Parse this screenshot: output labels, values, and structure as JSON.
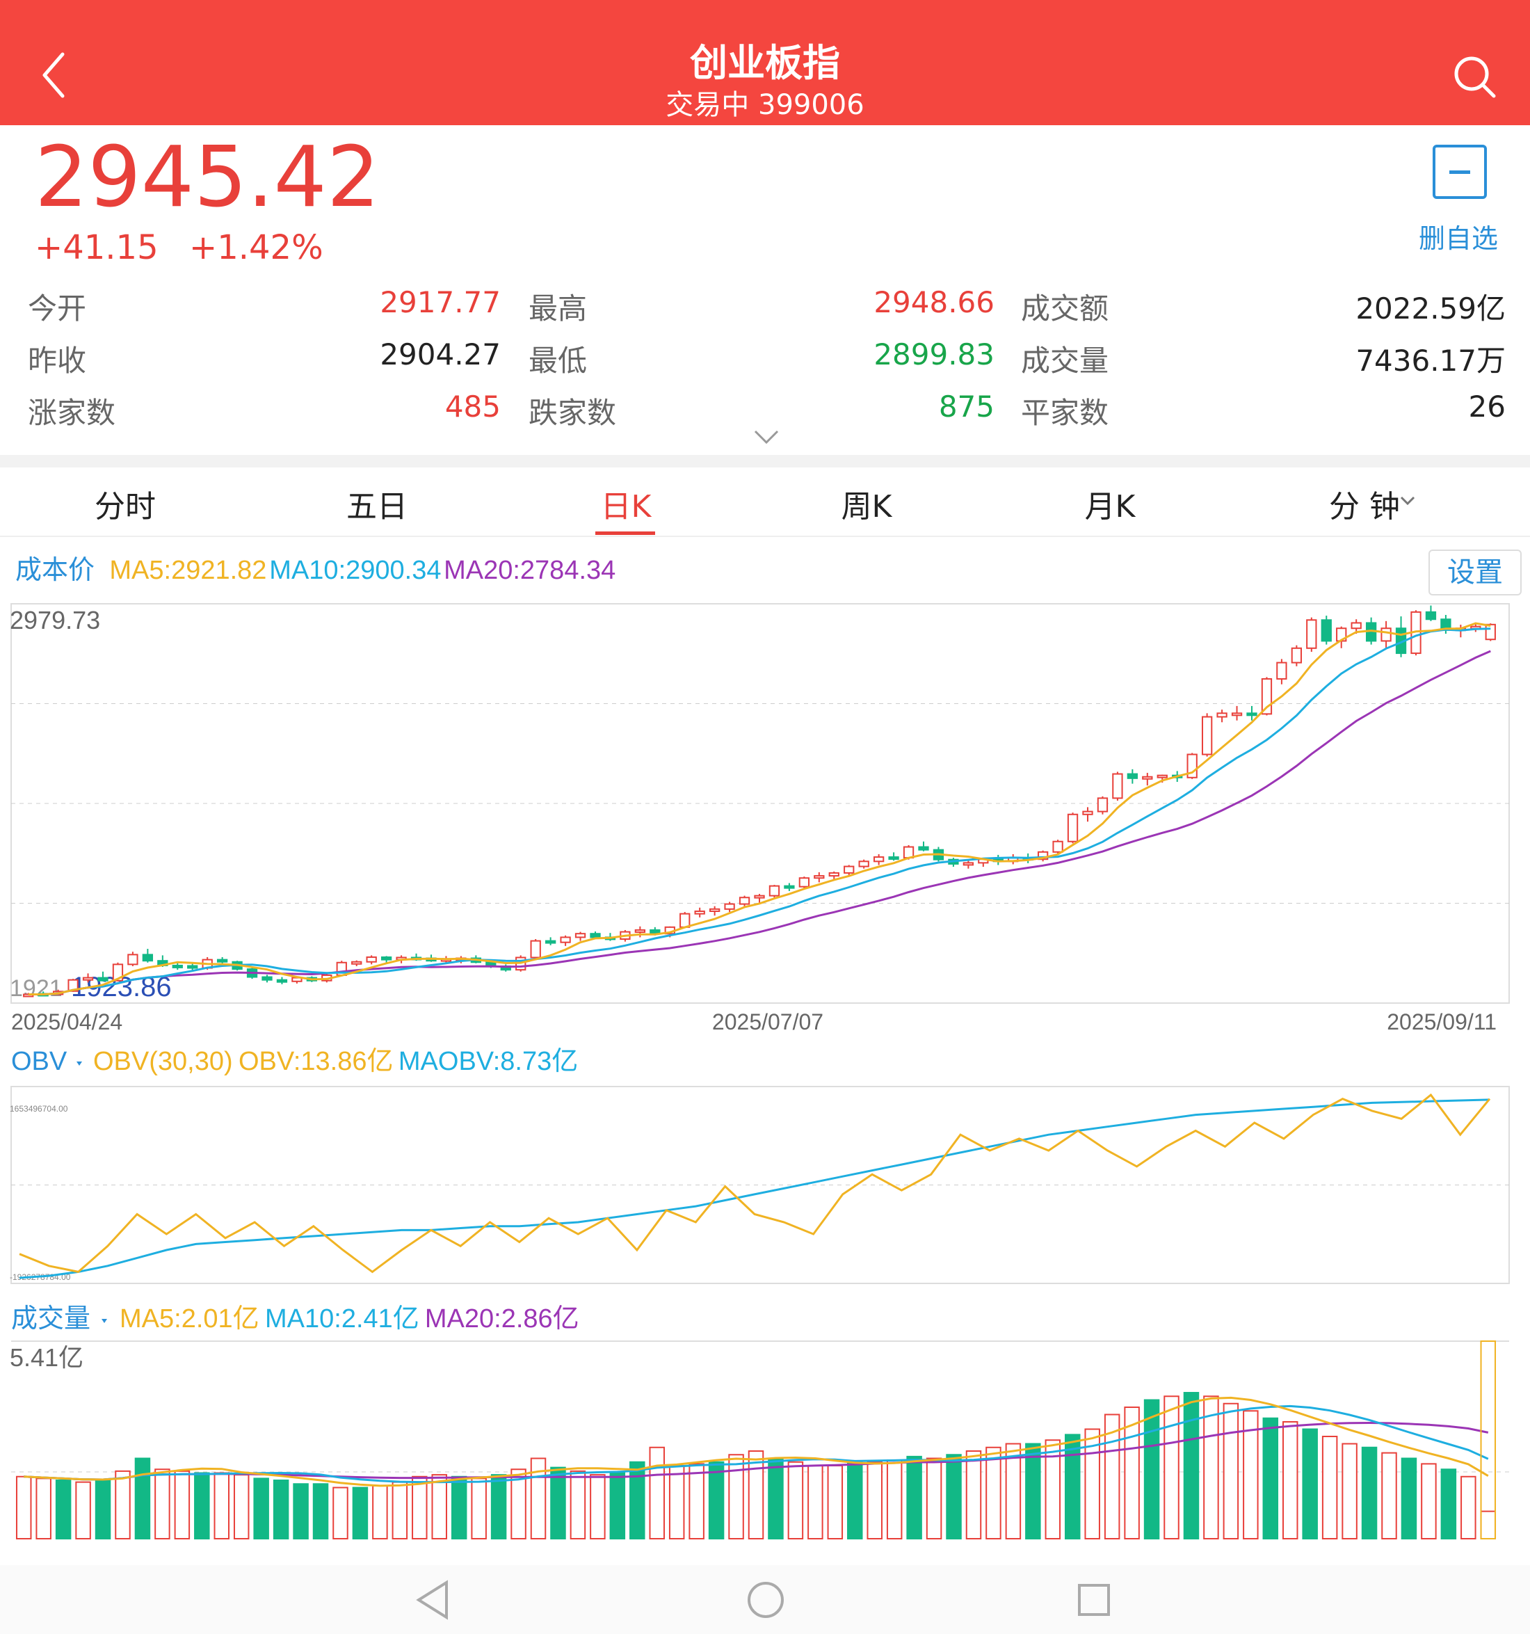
{
  "header": {
    "title": "创业板指",
    "subtitle": "交易中 399006"
  },
  "quote": {
    "price": "2945.42",
    "change": "+41.15",
    "change_pct": "+1.42%",
    "watch_label": "删自选",
    "stats": [
      [
        {
          "label": "今开",
          "value": "2917.77",
          "color": "red"
        },
        {
          "label": "最高",
          "value": "2948.66",
          "color": "red"
        },
        {
          "label": "成交额",
          "value": "2022.59亿",
          "color": "dark"
        }
      ],
      [
        {
          "label": "昨收",
          "value": "2904.27",
          "color": "dark"
        },
        {
          "label": "最低",
          "value": "2899.83",
          "color": "green"
        },
        {
          "label": "成交量",
          "value": "7436.17万",
          "color": "dark"
        }
      ],
      [
        {
          "label": "涨家数",
          "value": "485",
          "color": "red"
        },
        {
          "label": "跌家数",
          "value": "875",
          "color": "green"
        },
        {
          "label": "平家数",
          "value": "26",
          "color": "dark"
        }
      ]
    ]
  },
  "tabs": {
    "items": [
      "分时",
      "五日",
      "日K",
      "周K",
      "月K",
      "分 钟"
    ],
    "active": "日K"
  },
  "kline": {
    "cost_label": "成本价",
    "ma5": "MA5:2921.82",
    "ma10": "MA10:2900.34",
    "ma20": "MA20:2784.34",
    "settings": "设置",
    "y_max": "2979.73",
    "y_min_a": "1921",
    "y_min_b": "1923.86",
    "dates": [
      "2025/04/24",
      "2025/07/07",
      "2025/09/11"
    ]
  },
  "obv": {
    "label": "OBV",
    "params": "OBV(30,30)",
    "obv": "OBV:13.86亿",
    "maobv": "MAOBV:8.73亿",
    "y_max": "1653496704.00",
    "y_min": "-1926278784.00"
  },
  "volume": {
    "label": "成交量",
    "ma5": "MA5:2.01亿",
    "ma10": "MA10:2.41亿",
    "ma20": "MA20:2.86亿",
    "y_max": "5.41亿"
  },
  "colors": {
    "header": "#f4463f",
    "up": "#e8403a",
    "down": "#12b886",
    "ma5": "#f0b323",
    "ma10": "#1eaee0",
    "ma20": "#9b35b5",
    "link": "#2a8fd8"
  },
  "chart_data": [
    {
      "type": "candlestick",
      "title": "日K",
      "x_start": "2025/04/24",
      "x_end": "2025/09/11",
      "ylim": [
        1921,
        2979.73
      ],
      "ohlc": [
        [
          1921,
          1926,
          1918,
          1922
        ],
        [
          1924,
          1930,
          1919,
          1922
        ],
        [
          1922,
          1935,
          1920,
          1930
        ],
        [
          1931,
          1965,
          1929,
          1962
        ],
        [
          1962,
          1980,
          1955,
          1968
        ],
        [
          1968,
          1985,
          1958,
          1960
        ],
        [
          1960,
          2010,
          1958,
          2005
        ],
        [
          2005,
          2040,
          2000,
          2032
        ],
        [
          2032,
          2048,
          2010,
          2015
        ],
        [
          2015,
          2030,
          1998,
          2002
        ],
        [
          2002,
          2010,
          1990,
          2001
        ],
        [
          2001,
          2010,
          1985,
          1995
        ],
        [
          1995,
          2025,
          1990,
          2018
        ],
        [
          2018,
          2025,
          2006,
          2012
        ],
        [
          2012,
          2015,
          1988,
          1992
        ],
        [
          1992,
          1998,
          1965,
          1970
        ],
        [
          1970,
          1976,
          1955,
          1962
        ],
        [
          1962,
          1970,
          1950,
          1958
        ],
        [
          1958,
          1972,
          1952,
          1968
        ],
        [
          1968,
          1972,
          1956,
          1960
        ],
        [
          1960,
          1978,
          1955,
          1975
        ],
        [
          1975,
          2015,
          1972,
          2010
        ],
        [
          2010,
          2016,
          2000,
          2012
        ],
        [
          2012,
          2030,
          2005,
          2025
        ],
        [
          2025,
          2028,
          2010,
          2018
        ],
        [
          2018,
          2030,
          2008,
          2024
        ],
        [
          2024,
          2035,
          2015,
          2022
        ],
        [
          2022,
          2032,
          2012,
          2015
        ],
        [
          2015,
          2028,
          2010,
          2020
        ],
        [
          2020,
          2028,
          2008,
          2022
        ],
        [
          2022,
          2030,
          2008,
          2011
        ],
        [
          2011,
          2015,
          1995,
          2000
        ],
        [
          2000,
          2005,
          1985,
          1990
        ],
        [
          1990,
          2030,
          1985,
          2024
        ],
        [
          2024,
          2075,
          2020,
          2070
        ],
        [
          2070,
          2080,
          2058,
          2066
        ],
        [
          2066,
          2085,
          2056,
          2080
        ],
        [
          2080,
          2095,
          2070,
          2090
        ],
        [
          2090,
          2096,
          2075,
          2080
        ],
        [
          2080,
          2092,
          2070,
          2075
        ],
        [
          2075,
          2100,
          2068,
          2095
        ],
        [
          2095,
          2110,
          2080,
          2100
        ],
        [
          2100,
          2108,
          2085,
          2090
        ],
        [
          2090,
          2110,
          2080,
          2108
        ],
        [
          2108,
          2150,
          2105,
          2145
        ],
        [
          2145,
          2162,
          2135,
          2152
        ],
        [
          2152,
          2166,
          2140,
          2158
        ],
        [
          2158,
          2178,
          2150,
          2172
        ],
        [
          2172,
          2195,
          2165,
          2190
        ],
        [
          2190,
          2200,
          2175,
          2195
        ],
        [
          2195,
          2225,
          2190,
          2222
        ],
        [
          2222,
          2230,
          2208,
          2220
        ],
        [
          2220,
          2248,
          2215,
          2244
        ],
        [
          2244,
          2260,
          2232,
          2250
        ],
        [
          2250,
          2262,
          2240,
          2258
        ],
        [
          2258,
          2280,
          2250,
          2276
        ],
        [
          2276,
          2295,
          2270,
          2290
        ],
        [
          2290,
          2310,
          2280,
          2302
        ],
        [
          2302,
          2315,
          2292,
          2300
        ],
        [
          2300,
          2335,
          2295,
          2330
        ],
        [
          2330,
          2345,
          2318,
          2322
        ],
        [
          2322,
          2330,
          2290,
          2295
        ],
        [
          2295,
          2300,
          2275,
          2283
        ],
        [
          2283,
          2292,
          2270,
          2286
        ],
        [
          2286,
          2298,
          2275,
          2296
        ],
        [
          2296,
          2308,
          2280,
          2290
        ],
        [
          2290,
          2310,
          2282,
          2300
        ],
        [
          2300,
          2312,
          2285,
          2296
        ],
        [
          2296,
          2320,
          2290,
          2316
        ],
        [
          2316,
          2350,
          2310,
          2345
        ],
        [
          2345,
          2425,
          2340,
          2420
        ],
        [
          2420,
          2440,
          2400,
          2428
        ],
        [
          2428,
          2470,
          2420,
          2465
        ],
        [
          2465,
          2538,
          2458,
          2532
        ],
        [
          2532,
          2545,
          2505,
          2520
        ],
        [
          2520,
          2535,
          2500,
          2524
        ],
        [
          2524,
          2530,
          2508,
          2528
        ],
        [
          2528,
          2540,
          2510,
          2522
        ],
        [
          2522,
          2590,
          2518,
          2586
        ],
        [
          2586,
          2700,
          2580,
          2690
        ],
        [
          2690,
          2710,
          2675,
          2700
        ],
        [
          2700,
          2720,
          2680,
          2700
        ],
        [
          2700,
          2720,
          2680,
          2698
        ],
        [
          2698,
          2800,
          2694,
          2795
        ],
        [
          2795,
          2850,
          2780,
          2840
        ],
        [
          2840,
          2888,
          2830,
          2880
        ],
        [
          2880,
          2965,
          2870,
          2958
        ],
        [
          2958,
          2970,
          2890,
          2900
        ],
        [
          2900,
          2940,
          2880,
          2935
        ],
        [
          2935,
          2960,
          2920,
          2950
        ],
        [
          2950,
          2965,
          2890,
          2900
        ],
        [
          2900,
          2955,
          2880,
          2935
        ],
        [
          2935,
          2968,
          2855,
          2866
        ],
        [
          2866,
          2985,
          2860,
          2980
        ],
        [
          2980,
          2998,
          2955,
          2960
        ],
        [
          2960,
          2972,
          2920,
          2930
        ],
        [
          2930,
          2945,
          2910,
          2935
        ],
        [
          2935,
          2950,
          2925,
          2940
        ],
        [
          2904.27,
          2948.66,
          2899.83,
          2945.42
        ]
      ]
    },
    {
      "type": "line",
      "title": "OBV",
      "series": [
        {
          "name": "OBV",
          "values": [
            -1400000000.0,
            -1700000000.0,
            -1850000000.0,
            -1200000000.0,
            -400000000.0,
            -900000000.0,
            -400000000.0,
            -1000000000.0,
            -600000000.0,
            -1200000000.0,
            -700000000.0,
            -1300000000.0,
            -1850000000.0,
            -1300000000.0,
            -800000000.0,
            -1200000000.0,
            -600000000.0,
            -1100000000.0,
            -500000000.0,
            -900000000.0,
            -500000000.0,
            -1300000000.0,
            -300000000.0,
            -600000000.0,
            300000000.0,
            -400000000.0,
            -600000000.0,
            -900000000.0,
            100000000.0,
            600000000.0,
            200000000.0,
            600000000.0,
            1600000000.0,
            1200000000.0,
            1500000000.0,
            1200000000.0,
            1700000000.0,
            1200000000.0,
            800000000.0,
            1300000000.0,
            1700000000.0,
            1300000000.0,
            1900000000.0,
            1500000000.0,
            2100000000.0,
            2500000000.0,
            2200000000.0,
            2000000000.0,
            2600000000.0,
            1600000000.0,
            2500000000.0
          ]
        },
        {
          "name": "MAOBV",
          "values": [
            -2000000000.0,
            -1950000000.0,
            -1850000000.0,
            -1700000000.0,
            -1500000000.0,
            -1300000000.0,
            -1150000000.0,
            -1100000000.0,
            -1050000000.0,
            -1000000000.0,
            -950000000.0,
            -900000000.0,
            -850000000.0,
            -800000000.0,
            -800000000.0,
            -750000000.0,
            -700000000.0,
            -700000000.0,
            -650000000.0,
            -600000000.0,
            -500000000.0,
            -400000000.0,
            -300000000.0,
            -200000000.0,
            -50000000.0,
            100000000.0,
            250000000.0,
            400000000.0,
            550000000.0,
            700000000.0,
            850000000.0,
            1000000000.0,
            1150000000.0,
            1300000000.0,
            1450000000.0,
            1600000000.0,
            1700000000.0,
            1800000000.0,
            1900000000.0,
            2000000000.0,
            2100000000.0,
            2150000000.0,
            2200000000.0,
            2250000000.0,
            2300000000.0,
            2350000000.0,
            2400000000.0,
            2420000000.0,
            2440000000.0,
            2460000000.0,
            2480000000.0
          ]
        }
      ]
    },
    {
      "type": "bar",
      "title": "成交量",
      "ylim": [
        0,
        5.41
      ],
      "values": [
        1.7,
        1.65,
        1.6,
        1.55,
        1.6,
        1.85,
        2.2,
        1.9,
        1.85,
        1.8,
        1.8,
        1.75,
        1.65,
        1.6,
        1.5,
        1.5,
        1.4,
        1.4,
        1.45,
        1.55,
        1.7,
        1.75,
        1.7,
        1.65,
        1.75,
        1.9,
        2.2,
        1.95,
        1.85,
        1.75,
        1.8,
        2.1,
        2.5,
        2.0,
        2.05,
        2.1,
        2.3,
        2.4,
        2.2,
        2.1,
        2.0,
        2.0,
        2.1,
        2.1,
        2.15,
        2.25,
        2.2,
        2.3,
        2.4,
        2.5,
        2.6,
        2.6,
        2.7,
        2.85,
        3.0,
        3.4,
        3.6,
        3.8,
        3.9,
        4.0,
        3.9,
        3.7,
        3.5,
        3.3,
        3.2,
        3.0,
        2.8,
        2.6,
        2.5,
        2.35,
        2.2,
        2.05,
        1.9,
        1.7,
        0.75
      ],
      "up": [
        true,
        true,
        false,
        true,
        false,
        true,
        false,
        true,
        true,
        false,
        true,
        true,
        false,
        false,
        false,
        false,
        true,
        false,
        true,
        true,
        true,
        true,
        false,
        true,
        false,
        true,
        true,
        false,
        true,
        true,
        false,
        false,
        true,
        true,
        true,
        false,
        true,
        true,
        false,
        true,
        true,
        true,
        false,
        true,
        true,
        false,
        true,
        false,
        true,
        true,
        true,
        false,
        true,
        false,
        true,
        true,
        true,
        false,
        true,
        false,
        true,
        true,
        true,
        false,
        true,
        false,
        true,
        true,
        false,
        true,
        false,
        true,
        false,
        true,
        true
      ]
    }
  ]
}
